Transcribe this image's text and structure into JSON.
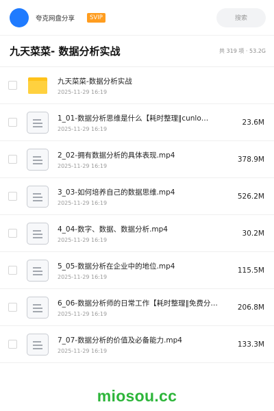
{
  "header": {
    "username": "夸克网盘分享",
    "badge": "SVIP",
    "search_placeholder": "搜索"
  },
  "folder": {
    "title": "九天菜菜- 数据分析实战",
    "stats": "共 319 项 · 53.2G"
  },
  "files": [
    {
      "icon": "folder-icon",
      "name": "九天菜菜-数据分析实战",
      "date": "2025-11-29 16:19",
      "size": ""
    },
    {
      "icon": "document-icon",
      "name": "1_01-数据分析思维是什么【耗时整理‖cunlo…",
      "date": "2025-11-29 16:19",
      "size": "23.6M"
    },
    {
      "icon": "document-icon",
      "name": "2_02-拥有数据分析的具体表现.mp4",
      "date": "2025-11-29 16:19",
      "size": "378.9M"
    },
    {
      "icon": "document-icon",
      "name": "3_03-如何培养自己的数据思维.mp4",
      "date": "2025-11-29 16:19",
      "size": "526.2M"
    },
    {
      "icon": "document-icon",
      "name": "4_04-数字、数据、数据分析.mp4",
      "date": "2025-11-29 16:19",
      "size": "30.2M"
    },
    {
      "icon": "document-icon",
      "name": "5_05-数据分析在企业中的地位.mp4",
      "date": "2025-11-29 16:19",
      "size": "115.5M"
    },
    {
      "icon": "document-icon",
      "name": "6_06-数据分析师的日常工作【耗时整理‖免费分享…",
      "date": "2025-11-29 16:19",
      "size": "206.8M"
    },
    {
      "icon": "document-icon",
      "name": "7_07-数据分析的价值及必备能力.mp4",
      "date": "2025-11-29 16:19",
      "size": "133.3M"
    }
  ],
  "watermark": "miosou.cc",
  "colors": {
    "avatar": "#1f7bff",
    "badge": "#ff9d1f",
    "folder": "#ffc21a",
    "watermark": "#2db53a"
  }
}
